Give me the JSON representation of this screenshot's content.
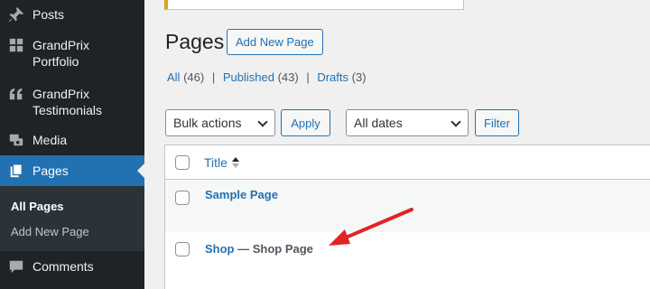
{
  "sidebar": {
    "items": [
      {
        "label": "Posts",
        "icon": "pushpin-icon"
      },
      {
        "label": "GrandPrix Portfolio",
        "icon": "grid-icon"
      },
      {
        "label": "GrandPrix Testimonials",
        "icon": "quote-icon"
      },
      {
        "label": "Media",
        "icon": "media-icon"
      },
      {
        "label": "Pages",
        "icon": "pages-icon",
        "active": true
      },
      {
        "label": "Comments",
        "icon": "comment-icon"
      }
    ],
    "submenu": {
      "all_pages": "All Pages",
      "add_new_page": "Add New Page"
    }
  },
  "header": {
    "title": "Pages",
    "add_new_label": "Add New Page"
  },
  "filters": {
    "all": {
      "label": "All",
      "count": "(46)"
    },
    "published": {
      "label": "Published",
      "count": "(43)"
    },
    "drafts": {
      "label": "Drafts",
      "count": "(3)"
    },
    "separator": "|"
  },
  "actions": {
    "bulk_selected": "Bulk actions",
    "apply_label": "Apply",
    "dates_selected": "All dates",
    "filter_label": "Filter"
  },
  "table": {
    "column_title": "Title",
    "rows": [
      {
        "title": "Sample Page",
        "state": ""
      },
      {
        "title": "Shop",
        "state": " — Shop Page"
      }
    ]
  },
  "colors": {
    "sidebar_bg": "#1d2327",
    "accent": "#2271b1",
    "annotation_arrow": "#e02424",
    "notice_border": "#dba617"
  }
}
